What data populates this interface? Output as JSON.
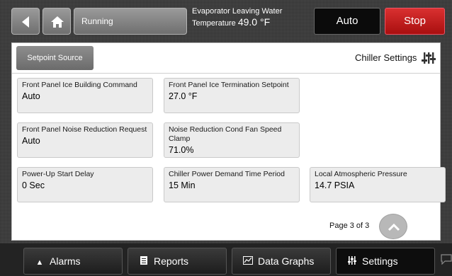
{
  "top_bar": {
    "status": "Running",
    "evap_line1": "Evaporator Leaving Water",
    "evap_line2_label": "Temperature",
    "evap_value": "49.0 °F",
    "mode_button": "Auto",
    "stop_button": "Stop"
  },
  "panel": {
    "setpoint_source_button": "Setpoint Source",
    "title": "Chiller Settings",
    "tiles": [
      {
        "label": "Front Panel Ice Building Command",
        "value": "Auto"
      },
      {
        "label": "Front Panel Ice Termination Setpoint",
        "value": "27.0 °F"
      },
      {
        "label": "Front Panel Noise Reduction Request",
        "value": "Auto"
      },
      {
        "label": "Noise Reduction Cond Fan Speed Clamp",
        "value": "71.0%"
      },
      {
        "label": "Power-Up Start Delay",
        "value": "0 Sec"
      },
      {
        "label": "Chiller Power Demand Time Period",
        "value": "15 Min"
      },
      {
        "label": "Local Atmospheric Pressure",
        "value": "14.7 PSIA"
      }
    ],
    "page_indicator": "Page 3 of 3"
  },
  "bottom_nav": {
    "alarms": "Alarms",
    "reports": "Reports",
    "data_graphs": "Data Graphs",
    "settings": "Settings"
  },
  "icons": {
    "back": "back-arrow-icon",
    "home": "home-icon",
    "settings": "sliders-icon",
    "page_up": "chevron-up-icon",
    "alarms": "bell-icon",
    "reports": "document-icon",
    "data_graphs": "graph-icon",
    "chat": "chat-icon"
  },
  "colors": {
    "stop": "#c41e1e",
    "mode": "#0b0b0b"
  }
}
